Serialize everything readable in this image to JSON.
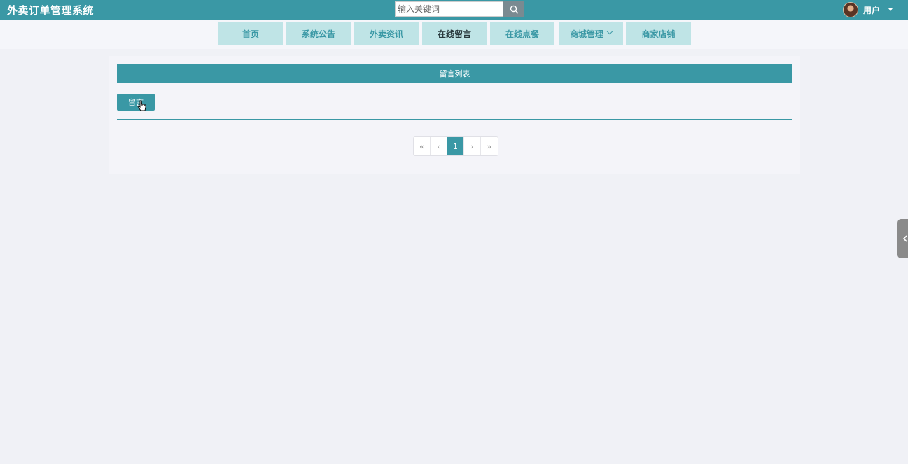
{
  "header": {
    "brand": "外卖订单管理系统",
    "search_placeholder": "输入关键词",
    "user_label": "用户"
  },
  "nav": {
    "items": [
      {
        "label": "首页"
      },
      {
        "label": "系统公告"
      },
      {
        "label": "外卖资讯"
      },
      {
        "label": "在线留言",
        "active": true
      },
      {
        "label": "在线点餐"
      },
      {
        "label": "商城管理",
        "has_dropdown": true
      },
      {
        "label": "商家店铺"
      }
    ]
  },
  "main": {
    "list_title": "留言列表",
    "action_label": "留言"
  },
  "pagination": {
    "first": "«",
    "prev": "‹",
    "current": "1",
    "next": "›",
    "last": "»"
  },
  "colors": {
    "accent": "#3a98a5",
    "nav_bg": "#bfe4e6",
    "page_bg": "#f0f1f6"
  },
  "icons": {
    "search": "search-icon",
    "avatar": "avatar",
    "dropdown": "chevron-down-icon",
    "side_toggle": "chevron-left-icon"
  }
}
